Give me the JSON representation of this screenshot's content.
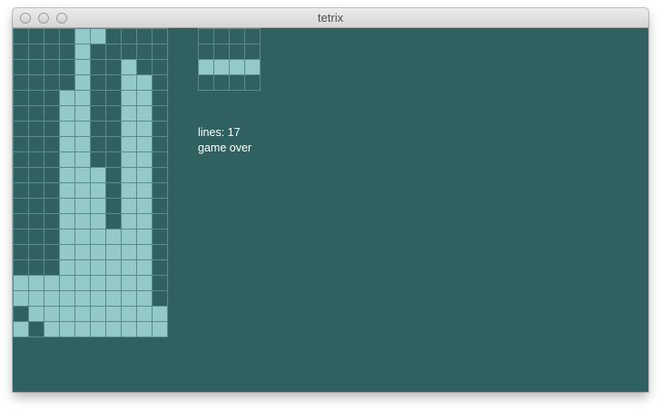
{
  "window": {
    "title": "tetrix"
  },
  "colors": {
    "background": "#2f6161",
    "filled": "#93c9c9",
    "grid_line": "#5a8a8a",
    "text": "#ffffff"
  },
  "board": {
    "columns": 10,
    "rows": 20,
    "cells": [
      "0000110000",
      "0000100000",
      "0000100100",
      "0000100110",
      "0001100110",
      "0001100110",
      "0001100110",
      "0001100110",
      "0001100110",
      "0001110110",
      "0001110110",
      "0001110110",
      "0001110110",
      "0001111110",
      "0001111110",
      "0001111110",
      "1111111110",
      "1111111110",
      "0111111111",
      "1011111111"
    ]
  },
  "next_piece": {
    "columns": 4,
    "rows": 4,
    "cells": [
      "0000",
      "0000",
      "1111",
      "0000"
    ]
  },
  "status": {
    "lines": "lines: 17",
    "state": "game over"
  }
}
